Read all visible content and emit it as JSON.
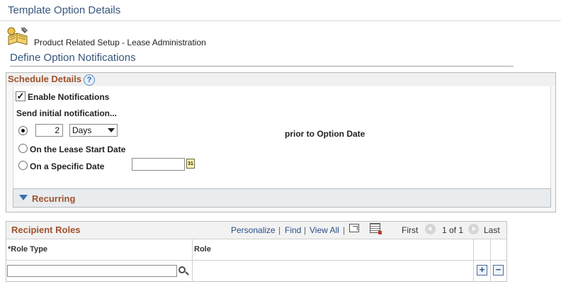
{
  "header": {
    "page_title": "Template Option Details",
    "breadcrumb": "Product Related Setup - Lease Administration",
    "subtitle": "Define Option Notifications"
  },
  "schedule": {
    "title": "Schedule Details",
    "help_glyph": "?",
    "enable_label": "Enable Notifications",
    "enable_checked": true,
    "send_label": "Send initial notification...",
    "count_value": "2",
    "unit_selected": "Days",
    "prior_label": "prior to Option Date",
    "lease_start_label": "On the Lease Start Date",
    "specific_label": "On a Specific Date",
    "specific_date_value": "",
    "calendar_glyph": "31",
    "selected_option": "prior to Option Date"
  },
  "recurring": {
    "label": "Recurring",
    "expanded": false
  },
  "grid": {
    "title": "Recipient Roles",
    "personalize": "Personalize",
    "find": "Find",
    "view_all": "View All",
    "separator": "|",
    "first": "First",
    "count": "1 of 1",
    "last": "Last",
    "columns": [
      "*Role Type",
      "Role"
    ],
    "rows": [
      {
        "role_type": "",
        "role": ""
      }
    ],
    "add_glyph": "+",
    "delete_glyph": "−"
  },
  "icons": {
    "breadcrumb": "book-wrench-icon",
    "help": "help-icon",
    "calendar": "calendar-icon",
    "collapse": "triangle-down-icon",
    "zoom": "zoom-icon",
    "download": "download-excel-icon",
    "prev": "arrow-left-icon",
    "next": "arrow-right-icon",
    "lookup": "search-icon",
    "add": "add-row-icon",
    "delete": "delete-row-icon"
  },
  "colors": {
    "title_blue": "#35557c",
    "section_brown": "#a0522d",
    "link_blue": "#2a4f8a"
  }
}
